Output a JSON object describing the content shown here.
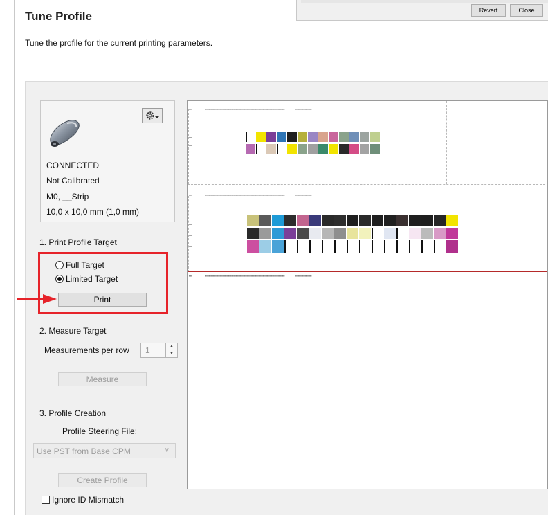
{
  "top_window": {
    "revert_label": "Revert",
    "close_label": "Close"
  },
  "header": {
    "title": "Tune Profile",
    "subtitle": "Tune the profile for the current printing parameters."
  },
  "device": {
    "status": "CONNECTED",
    "calibration": "Not Calibrated",
    "mode": "M0, __Strip",
    "aperture": "10,0 x 10,0 mm (1,0 mm)",
    "icons": {
      "device": "spectrophotometer-icon",
      "settings": "gear-dropdown-icon"
    }
  },
  "step1": {
    "label": "1. Print Profile Target",
    "options": [
      {
        "label": "Full Target",
        "selected": false
      },
      {
        "label": "Limited Target",
        "selected": true
      }
    ],
    "print_label": "Print"
  },
  "step2": {
    "label": "2. Measure Target",
    "measurements_label": "Measurements per row",
    "measurements_value": "1",
    "measure_label": "Measure"
  },
  "step3": {
    "label": "3. Profile Creation",
    "steering_label": "Profile Steering File:",
    "steering_value": "Use PST from Base CPM",
    "create_label": "Create Profile"
  },
  "ignore_mismatch": {
    "label": "Ignore ID Mismatch",
    "checked": false
  },
  "annotation_colors": {
    "highlight": "#e6232a"
  },
  "preview": {
    "strip_rows": [
      [
        "#ffffff",
        "#f2e400",
        "#7b3f98",
        "#2e75b6",
        "#1f1f1f",
        "#b6b03c",
        "#9a86c4",
        "#d9a48d",
        "#c9669c",
        "#8aa38b",
        "#6f8fb8",
        "#9ca4a0",
        "#bfcf8f"
      ],
      [
        "#b66ab2",
        "#ffffff",
        "#dbc9b7",
        "#ffffff",
        "#f2e400",
        "#8aa38b",
        "#a0a0a0",
        "#3b8a6b",
        "#f2e400",
        "#2a2a2a",
        "#d44c86",
        "#a3a3a3",
        "#6f8f7a"
      ],
      [
        "#c8c27a",
        "#5a5a5a",
        "#1e9bd7",
        "#2d2d2d",
        "#c2658f",
        "#3a3a7a",
        "#2a2a2a",
        "#2e2e2e",
        "#1f1f1f",
        "#2a2a2a",
        "#1f1f1f",
        "#202020",
        "#3a3030",
        "#1f1f1f",
        "#1e1e1e",
        "#262626",
        "#f2e400"
      ],
      [
        "#2a2a2a",
        "#9a9a9a",
        "#2e9ad6",
        "#7b3f98",
        "#4a4a4a",
        "#e8eaf0",
        "#b6b6b6",
        "#8e8e8e",
        "#e8e49c",
        "#f2f2bc",
        "#ffffff",
        "#e0e6f2",
        "#ffffff",
        "#f6e6f2",
        "#bbbbbb",
        "#d89ac6",
        "#c0399a"
      ],
      [
        "#cc4fa0",
        "#9ccde6",
        "#4aa3d8",
        "#ffffff",
        "#ffffff",
        "#ffffff",
        "#ffffff",
        "#ffffff",
        "#ffffff",
        "#ffffff",
        "#ffffff",
        "#ffffff",
        "#ffffff",
        "#ffffff",
        "#ffffff",
        "#ffffff",
        "#b0308c"
      ]
    ]
  }
}
